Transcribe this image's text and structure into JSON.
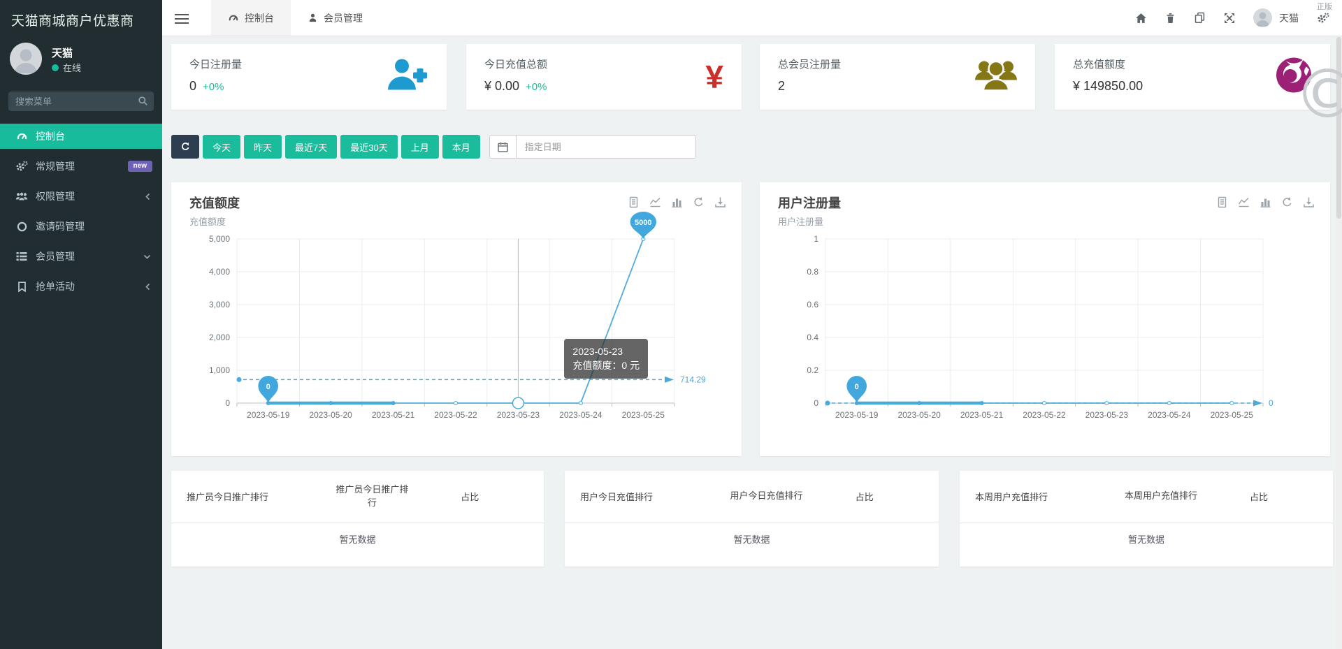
{
  "brand": {
    "title": "天猫商城商户优惠商"
  },
  "sidebar": {
    "user": {
      "name": "天猫",
      "status": "在线"
    },
    "search_placeholder": "搜索菜单",
    "items": [
      {
        "label": "控制台",
        "icon": "tachometer-icon",
        "active": true
      },
      {
        "label": "常规管理",
        "icon": "gears-icon",
        "badge": "new"
      },
      {
        "label": "权限管理",
        "icon": "users-icon",
        "chevron": "left"
      },
      {
        "label": "邀请码管理",
        "icon": "circle-o-icon"
      },
      {
        "label": "会员管理",
        "icon": "list-icon",
        "chevron": "down"
      },
      {
        "label": "抢单活动",
        "icon": "bookmark-icon",
        "chevron": "left"
      }
    ]
  },
  "topnav": {
    "tabs": [
      {
        "label": "控制台",
        "icon": "tachometer-icon",
        "active": true
      },
      {
        "label": "会员管理",
        "icon": "user-icon",
        "active": false
      }
    ],
    "right_icons": [
      "home-icon",
      "trash-icon",
      "copy-pages-icon",
      "fullscreen-icon",
      "gears-icon"
    ],
    "username": "天猫",
    "license": "正版",
    "watermark": "©"
  },
  "stats": [
    {
      "label": "今日注册量",
      "value": "0",
      "delta": "+0%",
      "icon": "user-plus-icon",
      "icon_color": "#1d9ad0"
    },
    {
      "label": "今日充值总额",
      "value": "¥ 0.00",
      "delta": "+0%",
      "icon": "yuan-icon",
      "icon_color": "#c9302c"
    },
    {
      "label": "总会员注册量",
      "value": "2",
      "icon": "user-group-icon",
      "icon_color": "#857716"
    },
    {
      "label": "总充值额度",
      "value": "¥ 149850.00",
      "icon": "firefox-icon",
      "icon_color": "#9c2076"
    }
  ],
  "filters": {
    "refresh_icon": "refresh-icon",
    "buttons": [
      "今天",
      "昨天",
      "最近7天",
      "最近30天",
      "上月",
      "本月"
    ],
    "date_placeholder": "指定日期",
    "accent_color": "#1abc9c"
  },
  "chart_data": [
    {
      "type": "line",
      "title": "充值额度",
      "subtitle": "充值额度",
      "x": [
        "2023-05-19",
        "2023-05-20",
        "2023-05-21",
        "2023-05-22",
        "2023-05-23",
        "2023-05-24",
        "2023-05-25"
      ],
      "series": [
        {
          "name": "充值额度",
          "values": [
            0,
            0,
            0,
            0,
            0,
            0,
            5000
          ]
        }
      ],
      "ylim": [
        0,
        5000
      ],
      "yticks": [
        "5,000",
        "4,000",
        "3,000",
        "2,000",
        "1,000",
        "0"
      ],
      "average_line": {
        "value": 714.29,
        "label": "714.29"
      },
      "markpoints": [
        {
          "x": "2023-05-19",
          "value": 0,
          "label": "0"
        },
        {
          "x": "2023-05-25",
          "value": 5000,
          "label": "5000"
        }
      ],
      "tooltip": {
        "title": "2023-05-23",
        "text": "充值额度：0 元",
        "x": "2023-05-23"
      },
      "line_color": "#49a9d8",
      "toolbox": [
        "data-view-icon",
        "line-chart-icon",
        "bar-chart-icon",
        "restore-icon",
        "save-image-icon"
      ]
    },
    {
      "type": "line",
      "title": "用户注册量",
      "subtitle": "用户注册量",
      "x": [
        "2023-05-19",
        "2023-05-20",
        "2023-05-21",
        "2023-05-22",
        "2023-05-23",
        "2023-05-24",
        "2023-05-25"
      ],
      "series": [
        {
          "name": "用户注册量",
          "values": [
            0,
            0,
            0,
            0,
            0,
            0,
            0
          ]
        }
      ],
      "ylim": [
        0,
        1
      ],
      "yticks": [
        "1",
        "0.8",
        "0.6",
        "0.4",
        "0.2",
        "0"
      ],
      "average_line": {
        "value": 0,
        "label": "0"
      },
      "markpoints": [
        {
          "x": "2023-05-19",
          "value": 0,
          "label": "0"
        }
      ],
      "line_color": "#49a9d8",
      "toolbox": [
        "data-view-icon",
        "line-chart-icon",
        "bar-chart-icon",
        "restore-icon",
        "save-image-icon"
      ]
    }
  ],
  "tables": [
    {
      "headers": [
        "推广员今日推广排行",
        "推广员今日推广排行",
        "占比"
      ],
      "empty": "暂无数据"
    },
    {
      "headers": [
        "用户今日充值排行",
        "用户今日充值排行",
        "占比"
      ],
      "empty": "暂无数据"
    },
    {
      "headers": [
        "本周用户充值排行",
        "本周用户充值排行",
        "占比"
      ],
      "empty": "暂无数据"
    }
  ]
}
